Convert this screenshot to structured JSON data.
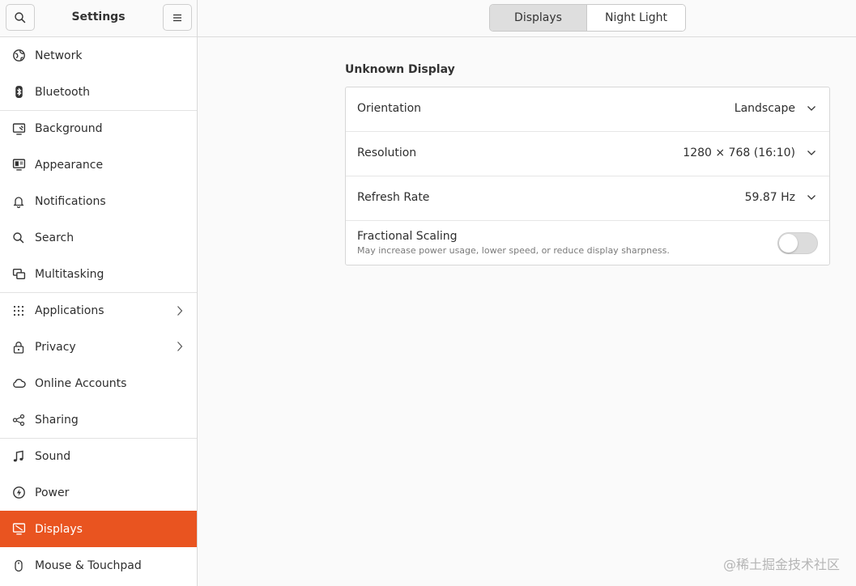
{
  "sidebar": {
    "title": "Settings",
    "items": [
      {
        "label": "Network",
        "icon": "globe-icon"
      },
      {
        "label": "Bluetooth",
        "icon": "bluetooth-icon"
      },
      {
        "label": "Background",
        "icon": "monitor-image-icon"
      },
      {
        "label": "Appearance",
        "icon": "appearance-icon"
      },
      {
        "label": "Notifications",
        "icon": "bell-icon"
      },
      {
        "label": "Search",
        "icon": "search-icon"
      },
      {
        "label": "Multitasking",
        "icon": "multitasking-icon"
      },
      {
        "label": "Applications",
        "icon": "grid-icon"
      },
      {
        "label": "Privacy",
        "icon": "lock-icon"
      },
      {
        "label": "Online Accounts",
        "icon": "cloud-icon"
      },
      {
        "label": "Sharing",
        "icon": "share-icon"
      },
      {
        "label": "Sound",
        "icon": "music-note-icon"
      },
      {
        "label": "Power",
        "icon": "power-icon"
      },
      {
        "label": "Displays",
        "icon": "display-icon",
        "active": true
      },
      {
        "label": "Mouse & Touchpad",
        "icon": "mouse-icon"
      }
    ]
  },
  "header": {
    "tabs": [
      {
        "label": "Displays",
        "selected": true
      },
      {
        "label": "Night Light",
        "selected": false
      }
    ]
  },
  "display": {
    "name": "Unknown Display",
    "orientation": {
      "label": "Orientation",
      "value": "Landscape"
    },
    "resolution": {
      "label": "Resolution",
      "value": "1280 × 768 (16:10)"
    },
    "refresh_rate": {
      "label": "Refresh Rate",
      "value": "59.87 Hz"
    },
    "fractional_scaling": {
      "label": "Fractional Scaling",
      "description": "May increase power usage, lower speed, or reduce display sharpness.",
      "enabled": false
    }
  },
  "colors": {
    "accent": "#e95420"
  },
  "watermark": "@稀土掘金技术社区"
}
